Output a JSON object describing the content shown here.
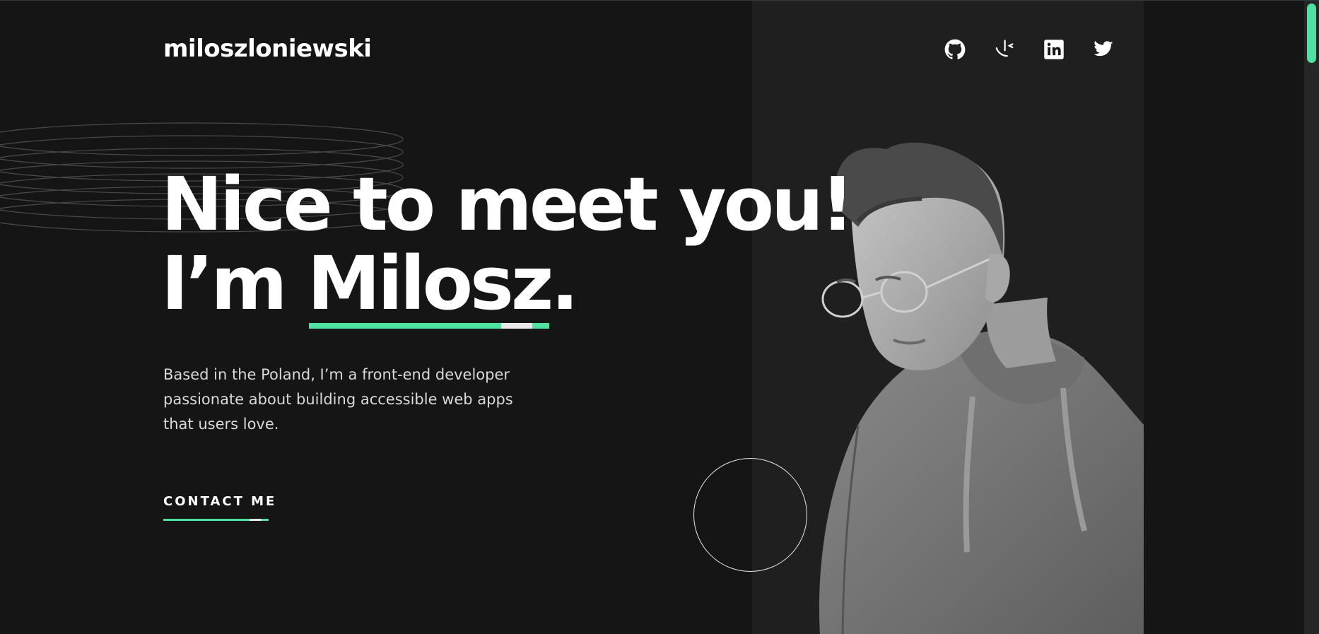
{
  "header": {
    "logo": "miloszloniewski",
    "social_links": [
      {
        "icon": "github-icon"
      },
      {
        "icon": "frontend-mentor-icon"
      },
      {
        "icon": "linkedin-icon"
      },
      {
        "icon": "twitter-icon"
      }
    ]
  },
  "hero": {
    "headline_line1": "Nice to meet you!",
    "headline_prefix": "I’m ",
    "headline_name": "Milosz",
    "headline_suffix": ".",
    "intro_lines": [
      "Based in the Poland, I’m a front-end developer",
      "passionate about building accessible web apps",
      "that users love."
    ],
    "contact_label": "CONTACT ME"
  },
  "colors": {
    "background": "#151515",
    "panel": "#1f1f1f",
    "accent": "#4ee1a0",
    "text": "#ffffff",
    "body_text": "#d9d9d9"
  }
}
